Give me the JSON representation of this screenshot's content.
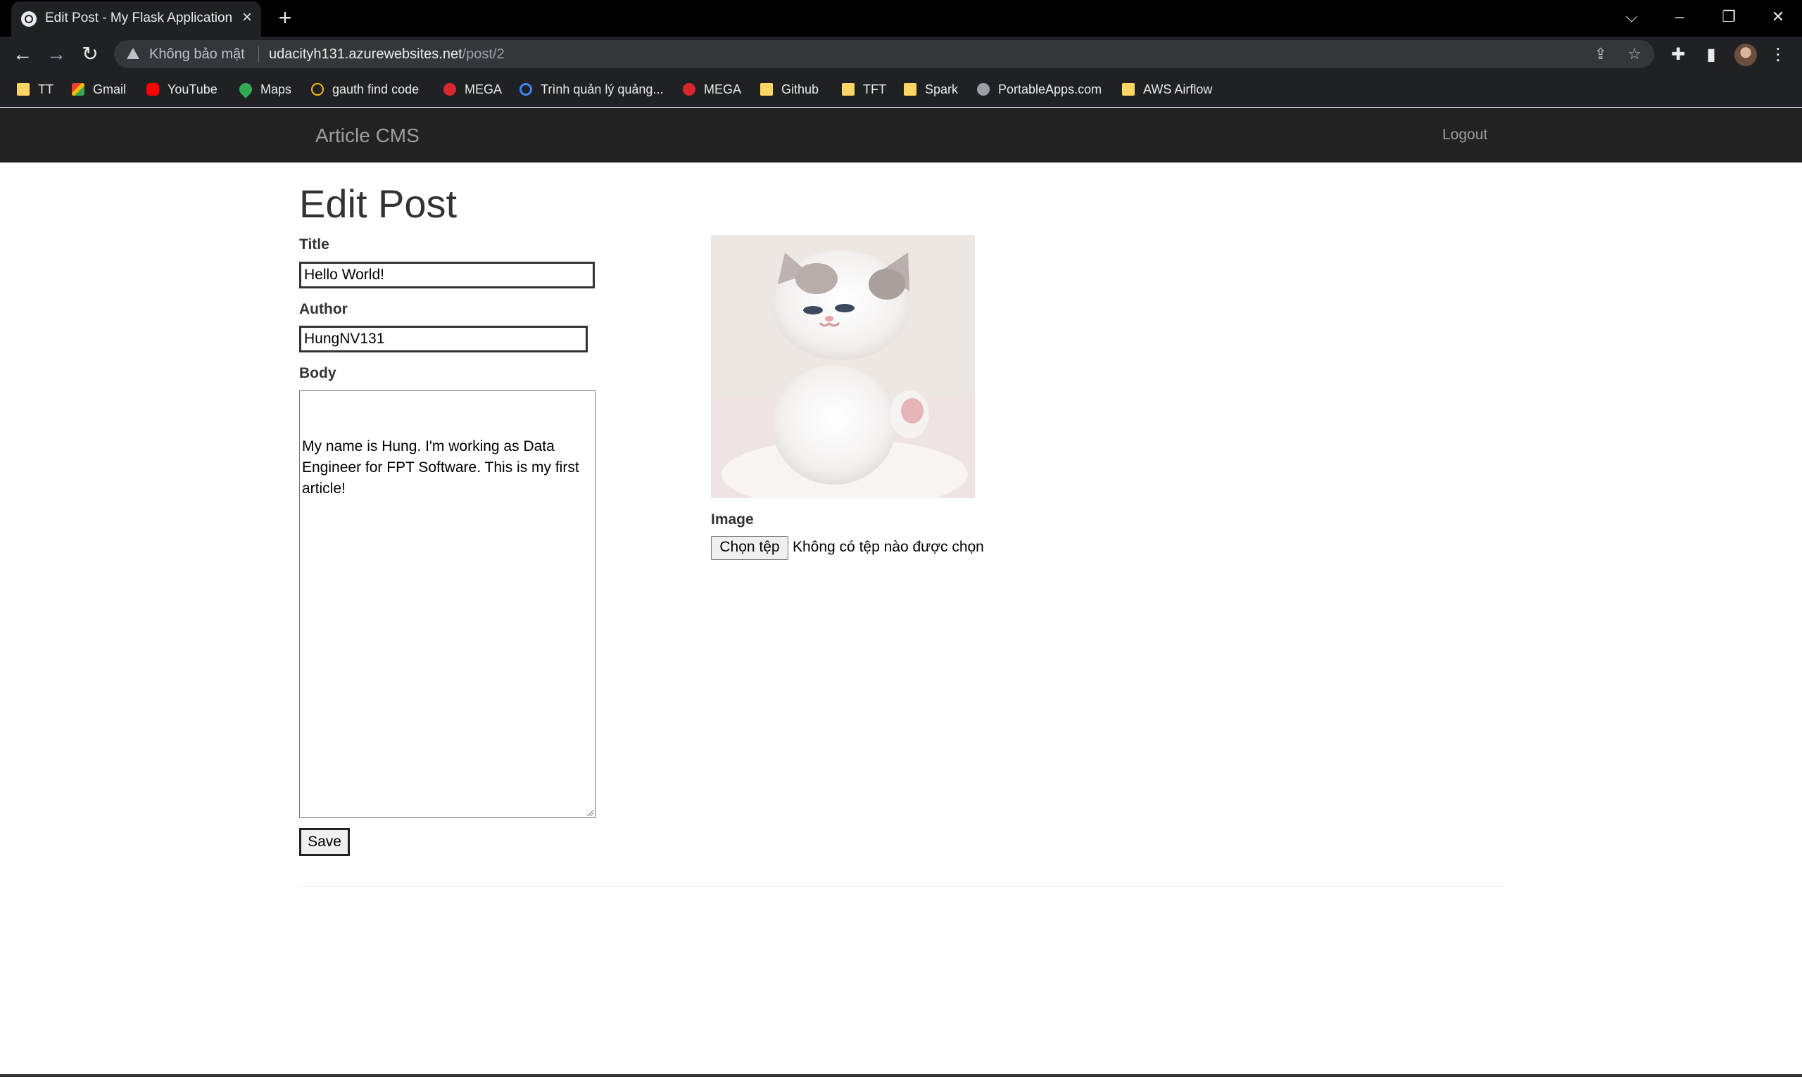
{
  "browser": {
    "tab_title": "Edit Post - My Flask Application",
    "security_label": "Không bảo mật",
    "url_host": "udacityh131.azurewebsites.net",
    "url_path": "/post/2",
    "bookmarks": [
      {
        "label": "TT",
        "icon": "folder-icon"
      },
      {
        "label": "Gmail",
        "icon": "gmail-icon"
      },
      {
        "label": "YouTube",
        "icon": "youtube-icon"
      },
      {
        "label": "Maps",
        "icon": "maps-icon"
      },
      {
        "label": "gauth find code",
        "icon": "gauth-icon"
      },
      {
        "label": "MEGA",
        "icon": "mega-icon"
      },
      {
        "label": "Trình quản lý quảng...",
        "icon": "meta-icon"
      },
      {
        "label": "MEGA",
        "icon": "mega-icon"
      },
      {
        "label": "Github",
        "icon": "folder-icon"
      },
      {
        "label": "TFT",
        "icon": "folder-icon"
      },
      {
        "label": "Spark",
        "icon": "folder-icon"
      },
      {
        "label": "PortableApps.com",
        "icon": "portableapps-icon"
      },
      {
        "label": "AWS Airflow",
        "icon": "folder-icon"
      }
    ]
  },
  "navbar": {
    "brand": "Article CMS",
    "logout": "Logout"
  },
  "form": {
    "heading": "Edit Post",
    "title_label": "Title",
    "title_value": "Hello World!",
    "author_label": "Author",
    "author_value": "HungNV131",
    "body_label": "Body",
    "body_value": "My name is Hung. I'm working as Data Engineer for FPT Software. This is my first article!",
    "save_label": "Save",
    "image_label": "Image",
    "file_button_label": "Chọn tệp",
    "file_status": "Không có tệp nào được chọn"
  }
}
